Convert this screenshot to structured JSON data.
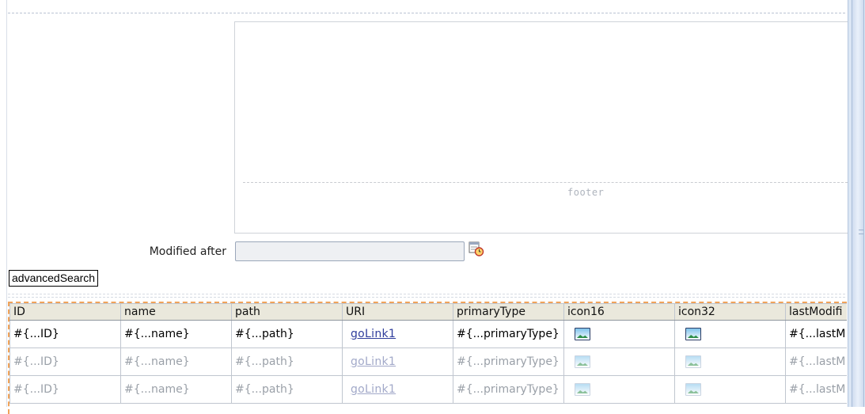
{
  "footer": {
    "label": "footer"
  },
  "form": {
    "modified_after_label": "Modified after",
    "modified_after_value": "",
    "calendar_icon": "calendar-clock-icon"
  },
  "advanced_search": {
    "label": "advancedSearch"
  },
  "grid": {
    "columns": [
      "ID",
      "name",
      "path",
      "URI",
      "primaryType",
      "icon16",
      "icon32",
      "lastModifi"
    ],
    "rows": [
      {
        "id": "#{...ID}",
        "name": "#{...name}",
        "path": "#{...path}",
        "uri": "goLink1",
        "primaryType": "#{...primaryType}",
        "icon16": "image-icon",
        "icon32": "image-icon",
        "lastModified": "#{...lastM"
      },
      {
        "id": "#{...ID}",
        "name": "#{...name}",
        "path": "#{...path}",
        "uri": "goLink1",
        "primaryType": "#{...primaryType}",
        "icon16": "image-icon",
        "icon32": "image-icon",
        "lastModified": "#{...lastM"
      },
      {
        "id": "#{...ID}",
        "name": "#{...name}",
        "path": "#{...path}",
        "uri": "goLink1",
        "primaryType": "#{...primaryType}",
        "icon16": "image-icon",
        "icon32": "image-icon",
        "lastModified": "#{...lastM"
      }
    ]
  }
}
